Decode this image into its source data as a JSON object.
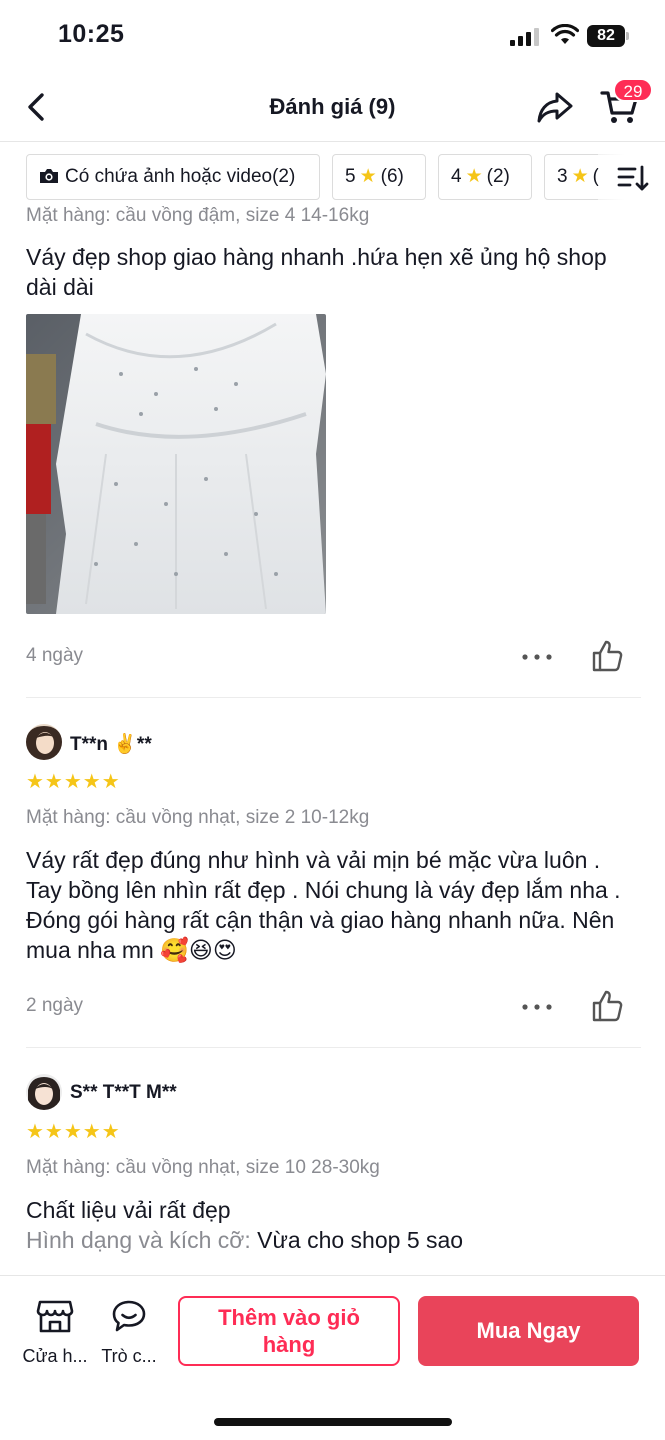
{
  "status_bar": {
    "time": "10:25",
    "battery": "82"
  },
  "header": {
    "title": "Đánh giá (9)",
    "cart_count": "29"
  },
  "filters": {
    "media_chip": "Có chứa ảnh hoặc video(2)",
    "five_star_value": "5",
    "five_star_count": "(6)",
    "four_star_value": "4",
    "four_star_count": "(2)",
    "three_star_value": "3",
    "three_star_count": "(",
    "star_glyph": "★"
  },
  "reviews": [
    {
      "variant": "Mặt hàng: cầu vồng đậm, size 4 14-16kg",
      "text": "Váy đẹp shop giao hàng nhanh .hứa hẹn xẽ ủng hộ shop dài dài",
      "age": "4 ngày"
    },
    {
      "user": "T**n ✌️**",
      "stars": "★★★★★",
      "variant": "Mặt hàng: cầu vồng nhạt, size 2 10-12kg",
      "text": "Váy rất đẹp đúng như hình và vải mịn bé mặc vừa luôn . Tay bồng lên nhìn rất đẹp . Nói chung là váy đẹp lắm nha . Đóng gói hàng rất cận thận và giao hàng nhanh nữa. Nên mua nha mn 🥰😆😍",
      "age": "2 ngày"
    },
    {
      "user": "S** T**T M**",
      "stars": "★★★★★",
      "variant": "Mặt hàng: cầu vồng nhạt, size 10 28-30kg",
      "line1": "Chất liệu vải rất đẹp",
      "line2_label": "Hình dạng và kích cỡ:",
      "line2_value": " Vừa cho shop 5 sao"
    }
  ],
  "bottom_bar": {
    "shop_label": "Cửa h...",
    "chat_label": "Trò c...",
    "add_to_cart": "Thêm vào giỏ hàng",
    "buy_now": "Mua Ngay"
  },
  "colors": {
    "accent": "#fe2c55",
    "buy_button": "#e9445a",
    "star": "#f5c518",
    "muted_text": "#8a8b91"
  }
}
